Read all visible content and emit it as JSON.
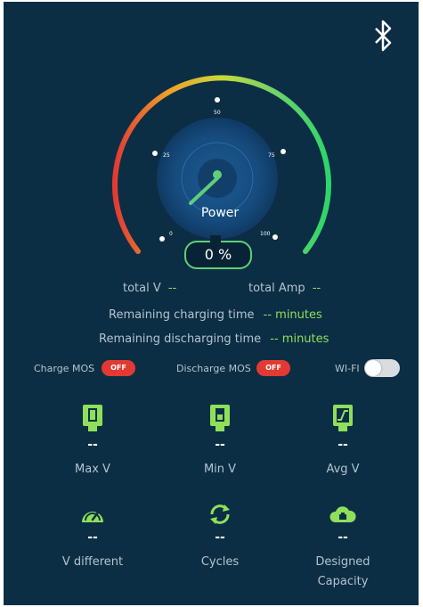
{
  "gauge": {
    "label": "Power",
    "percent_text": "0 %",
    "percent_value": 0,
    "ticks": [
      "0",
      "25",
      "50",
      "75",
      "100"
    ]
  },
  "readings": {
    "total_v_label": "total V",
    "total_v_value": "--",
    "total_amp_label": "total Amp",
    "total_amp_value": "--",
    "charging_label": "Remaining charging time",
    "charging_value": "-- minutes",
    "discharging_label": "Remaining discharging time",
    "discharging_value": "-- minutes"
  },
  "switches": {
    "charge_mos_label": "Charge MOS",
    "charge_mos_state": "OFF",
    "discharge_mos_label": "Discharge MOS",
    "discharge_mos_state": "OFF",
    "wifi_label": "WI-FI"
  },
  "stats": [
    {
      "label": "Max V",
      "value": "--",
      "icon": "battery-max-icon"
    },
    {
      "label": "Min V",
      "value": "--",
      "icon": "battery-min-icon"
    },
    {
      "label": "Avg V",
      "value": "--",
      "icon": "battery-avg-icon"
    },
    {
      "label": "V different",
      "value": "--",
      "icon": "speedometer-icon"
    },
    {
      "label": "Cycles",
      "value": "--",
      "icon": "cycle-icon"
    },
    {
      "label": "Designed Capacity",
      "value": "--",
      "icon": "capacity-cloud-icon"
    }
  ],
  "colors": {
    "background": "#0b2e45",
    "accent_green": "#5fcf78",
    "value_green": "#8ee05a",
    "off_red": "#e23a33"
  }
}
